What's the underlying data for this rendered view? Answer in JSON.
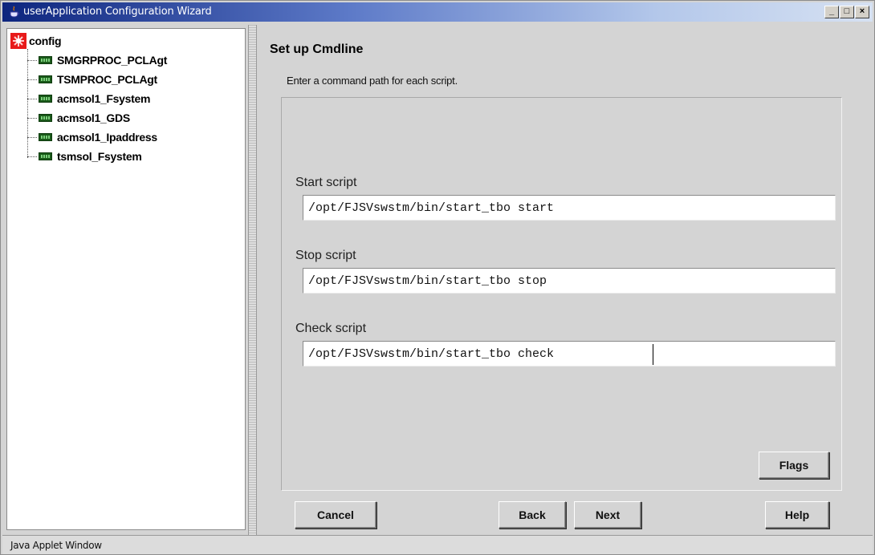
{
  "window": {
    "title": "userApplication Configuration Wizard",
    "minimize_glyph": "_",
    "maximize_glyph": "□",
    "close_glyph": "×",
    "titlebar_color": "#0d257e"
  },
  "tree": {
    "root_label": "config",
    "root_icon": "red-config-icon",
    "node_icon": "resource-node-icon",
    "items": [
      {
        "label": "SMGRPROC_PCLAgt"
      },
      {
        "label": "TSMPROC_PCLAgt"
      },
      {
        "label": "acmsol1_Fsystem"
      },
      {
        "label": "acmsol1_GDS"
      },
      {
        "label": "acmsol1_Ipaddress"
      },
      {
        "label": "tsmsol_Fsystem"
      }
    ]
  },
  "main": {
    "title": "Set up Cmdline",
    "instructions": "Enter a command path for each script.",
    "fields": [
      {
        "label": "Start script",
        "value": "/opt/FJSVswstm/bin/start_tbo start"
      },
      {
        "label": "Stop script",
        "value": "/opt/FJSVswstm/bin/start_tbo stop"
      },
      {
        "label": "Check script",
        "value": "/opt/FJSVswstm/bin/start_tbo check"
      }
    ],
    "flags_label": "Flags"
  },
  "buttons": {
    "cancel": "Cancel",
    "back": "Back",
    "next": "Next",
    "help": "Help"
  },
  "status": {
    "text": "Java Applet Window"
  }
}
